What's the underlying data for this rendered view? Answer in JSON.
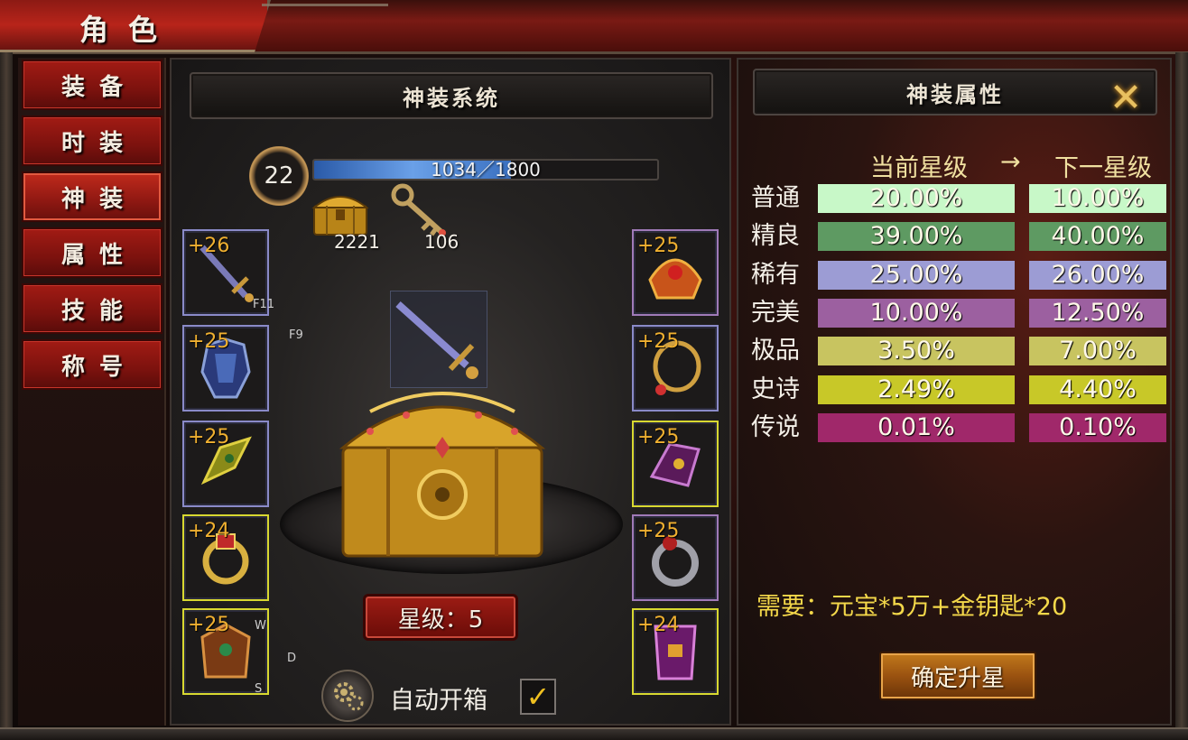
{
  "window": {
    "title": "角色"
  },
  "sidebar": {
    "tabs": [
      {
        "label": "装备",
        "active": false
      },
      {
        "label": "时装",
        "active": false
      },
      {
        "label": "神装",
        "active": true
      },
      {
        "label": "属性",
        "active": false
      },
      {
        "label": "技能",
        "active": false
      },
      {
        "label": "称号",
        "active": false
      }
    ]
  },
  "center": {
    "title": "神装系统",
    "level": "22",
    "xp": {
      "current": 1034,
      "max": 1800,
      "text": "1034／1800",
      "fill_fraction": 0.574
    },
    "resources": [
      {
        "icon": "gold-chest-icon",
        "count": "2221"
      },
      {
        "icon": "gold-key-icon",
        "count": "106"
      }
    ],
    "left_slots": [
      {
        "plus": "+26",
        "key": "F11",
        "border": "blue"
      },
      {
        "plus": "+25",
        "key": "F9",
        "border": "blue"
      },
      {
        "plus": "+25",
        "key": "",
        "border": "blue"
      },
      {
        "plus": "+24",
        "key": "",
        "border": "yellow"
      },
      {
        "plus": "+25",
        "key": "W",
        "border": "yellow"
      }
    ],
    "left_slot_extra_keys": [
      "D",
      "S"
    ],
    "right_slots": [
      {
        "plus": "+25",
        "border": "purple"
      },
      {
        "plus": "+25",
        "border": "blue"
      },
      {
        "plus": "+25",
        "border": "yellow"
      },
      {
        "plus": "+25",
        "border": "purple"
      },
      {
        "plus": "+24",
        "border": "yellow"
      }
    ],
    "star_level": "星级：5",
    "auto_open_label": "自动开箱",
    "auto_open_checked": true,
    "checkmark": "✓"
  },
  "attributes": {
    "title": "神装属性",
    "close_glyph": "✕",
    "col_current": "当前星级",
    "col_arrow": "→",
    "col_next": "下一星级",
    "rows": [
      {
        "label": "普通",
        "current": "20.00%",
        "next": "10.00%",
        "color": "#c8f8c8"
      },
      {
        "label": "精良",
        "current": "39.00%",
        "next": "40.00%",
        "color": "#5e9a62"
      },
      {
        "label": "稀有",
        "current": "25.00%",
        "next": "26.00%",
        "color": "#9c9cd4"
      },
      {
        "label": "完美",
        "current": "10.00%",
        "next": "12.50%",
        "color": "#9c60a0"
      },
      {
        "label": "极品",
        "current": "3.50%",
        "next": "7.00%",
        "color": "#c8c460"
      },
      {
        "label": "史诗",
        "current": "2.49%",
        "next": "4.40%",
        "color": "#c8c828"
      },
      {
        "label": "传说",
        "current": "0.01%",
        "next": "0.10%",
        "color": "#a0286a"
      }
    ],
    "requirement": "需要：元宝*5万+金钥匙*20",
    "confirm_label": "确定升星"
  }
}
